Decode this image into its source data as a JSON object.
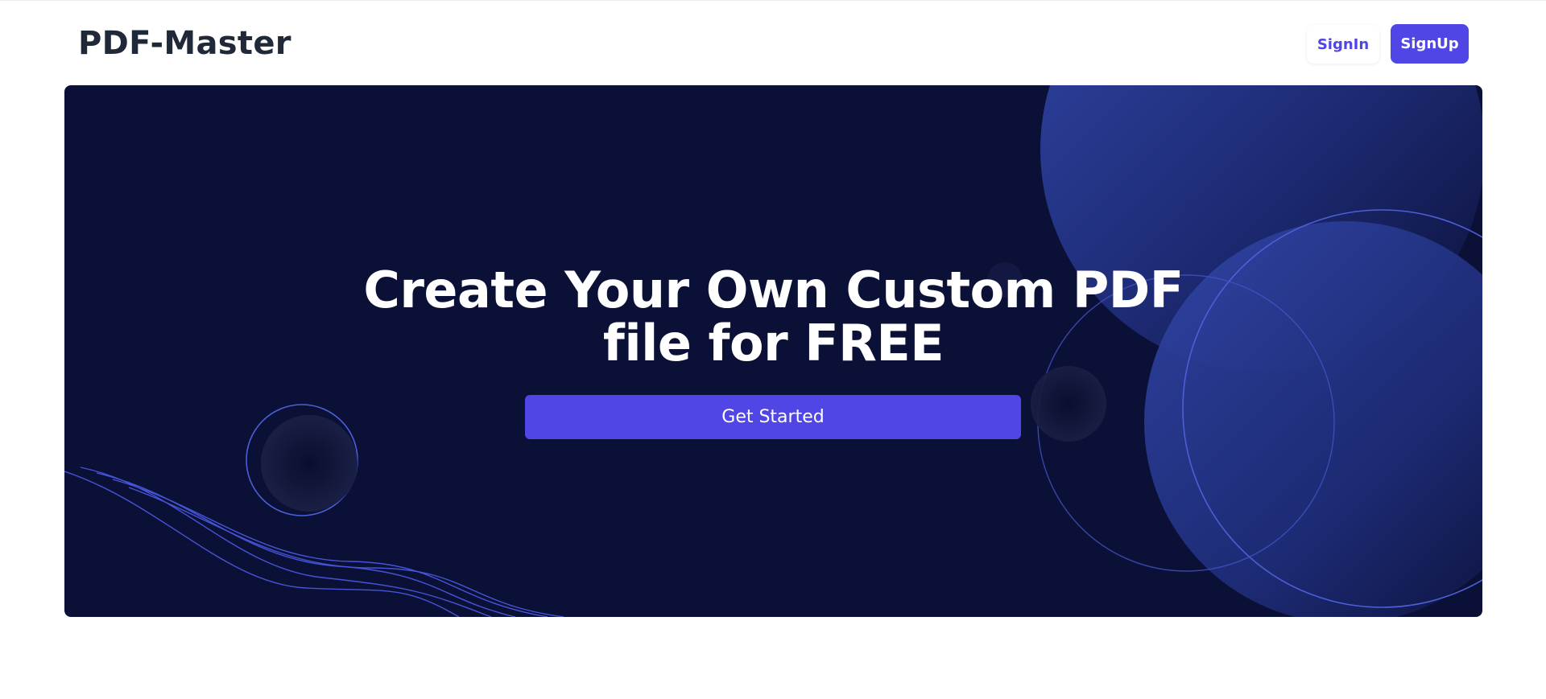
{
  "header": {
    "logo": "PDF-Master",
    "signin_label": "SignIn",
    "signup_label": "SignUp"
  },
  "hero": {
    "title_line1": "Create Your Own Custom PDF",
    "title_line2": "file for FREE",
    "cta_label": "Get Started"
  },
  "colors": {
    "accent": "#4f46e5",
    "hero_background": "#0b1036",
    "text_dark": "#1f2937"
  }
}
